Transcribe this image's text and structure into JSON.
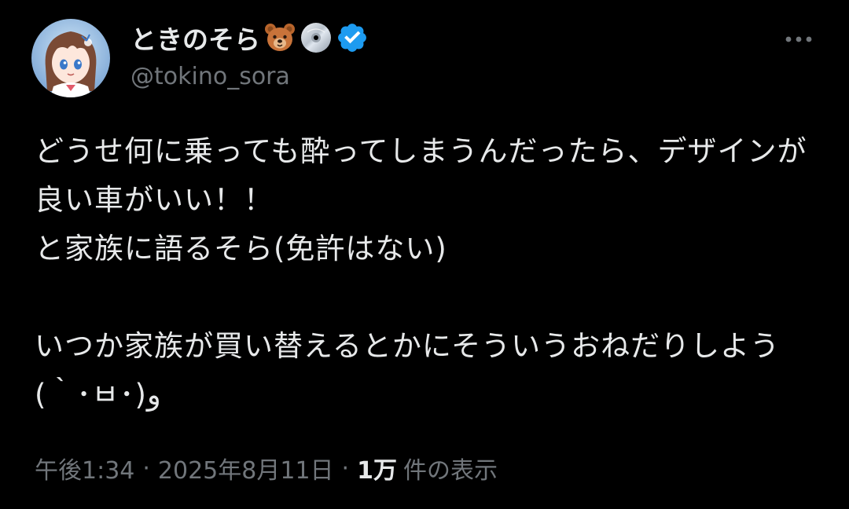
{
  "author": {
    "display_name": "ときのそら",
    "name_emojis": [
      "bear-face-icon",
      "dvd-icon"
    ],
    "verified": true,
    "verified_icon": "verified-badge-icon",
    "handle": "@tokino_sora",
    "avatar": "avatar"
  },
  "tweet": {
    "text": "どうせ何に乗っても酔ってしまうんだったら、デザインが良い車がいい！！\nと家族に語るそら(免許はない)\n\nいつか家族が買い替えるとかにそういうおねだりしよう(｀･ㅂ･)و",
    "time": "午後1:34",
    "separator": "·",
    "date": "2025年8月11日",
    "views_count": "1万",
    "views_label": "件の表示"
  },
  "menu": {
    "icon": "more-horizontal-icon"
  },
  "colors": {
    "background": "#000000",
    "text_primary": "#e7e9ea",
    "text_secondary": "#71767b",
    "verified_blue": "#1d9bf0"
  }
}
